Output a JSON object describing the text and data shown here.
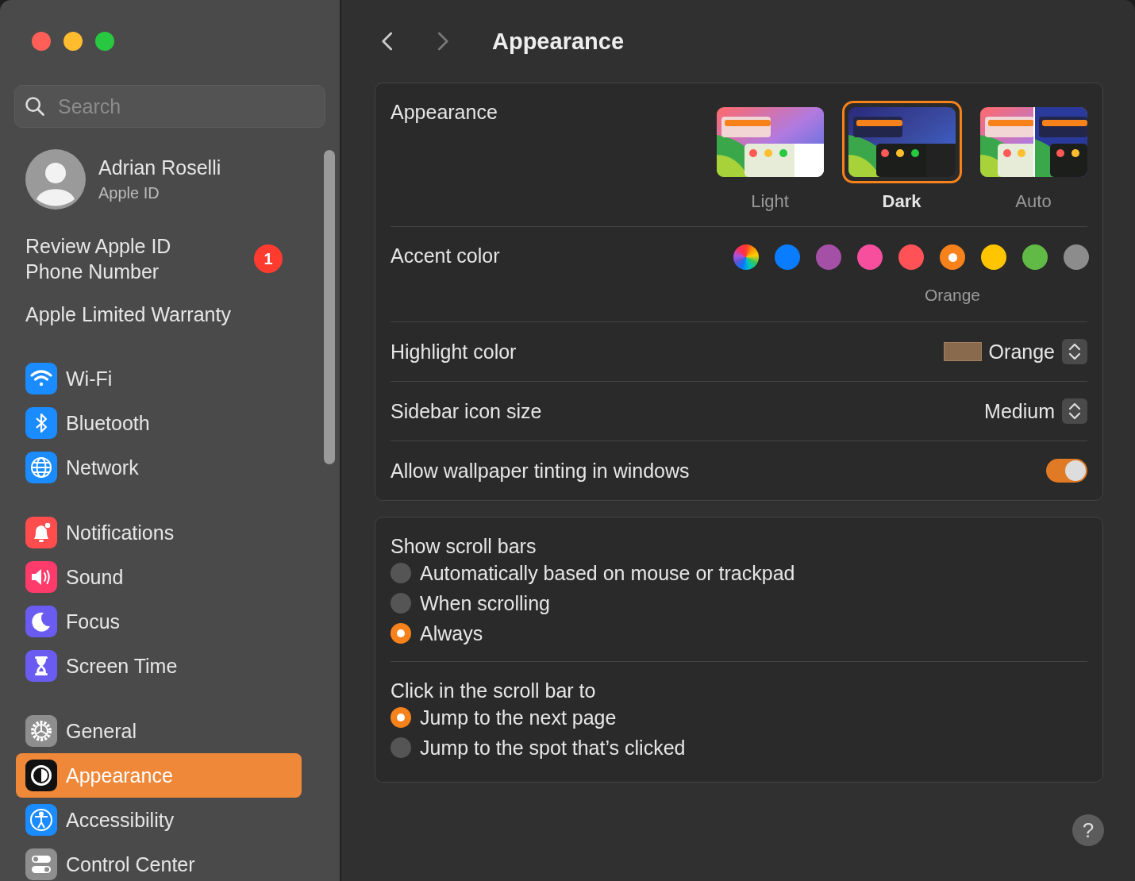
{
  "window": {
    "title": "Appearance"
  },
  "sidebar": {
    "search": {
      "placeholder": "Search"
    },
    "profile": {
      "name": "Adrian Roselli",
      "subtitle": "Apple ID"
    },
    "notices": [
      {
        "label": "Review Apple ID Phone Number",
        "badge": "1"
      },
      {
        "label": "Apple Limited Warranty"
      }
    ],
    "groups": [
      [
        {
          "kind": "wifi",
          "label": "Wi-Fi",
          "selected": false
        },
        {
          "kind": "bluetooth",
          "label": "Bluetooth",
          "selected": false
        },
        {
          "kind": "network",
          "label": "Network",
          "selected": false
        }
      ],
      [
        {
          "kind": "notifications",
          "label": "Notifications",
          "selected": false
        },
        {
          "kind": "sound",
          "label": "Sound",
          "selected": false
        },
        {
          "kind": "focus",
          "label": "Focus",
          "selected": false
        },
        {
          "kind": "screentime",
          "label": "Screen Time",
          "selected": false
        }
      ],
      [
        {
          "kind": "general",
          "label": "General",
          "selected": false
        },
        {
          "kind": "appearance",
          "label": "Appearance",
          "selected": true
        },
        {
          "kind": "accessibility",
          "label": "Accessibility",
          "selected": false
        },
        {
          "kind": "controlcenter",
          "label": "Control Center",
          "selected": false
        }
      ]
    ]
  },
  "appearance": {
    "label": "Appearance",
    "options": [
      {
        "kind": "light",
        "label": "Light",
        "selected": false
      },
      {
        "kind": "dark",
        "label": "Dark",
        "selected": true
      },
      {
        "kind": "auto",
        "label": "Auto",
        "selected": false
      }
    ]
  },
  "accent": {
    "label": "Accent color",
    "selected_name": "Orange",
    "colors": [
      {
        "kind": "multicolor",
        "selected": false
      },
      {
        "kind": "solid",
        "color": "#0a7cff",
        "selected": false
      },
      {
        "kind": "solid",
        "color": "#a550a7",
        "selected": false
      },
      {
        "kind": "solid",
        "color": "#f74f9e",
        "selected": false
      },
      {
        "kind": "solid",
        "color": "#ff5257",
        "selected": false
      },
      {
        "kind": "solid",
        "color": "#f7821b",
        "selected": true
      },
      {
        "kind": "solid",
        "color": "#ffc600",
        "selected": false
      },
      {
        "kind": "solid",
        "color": "#62ba46",
        "selected": false
      },
      {
        "kind": "solid",
        "color": "#8c8c8c",
        "selected": false
      }
    ]
  },
  "highlight": {
    "label": "Highlight color",
    "value": "Orange"
  },
  "icon_size": {
    "label": "Sidebar icon size",
    "value": "Medium"
  },
  "tinting": {
    "label": "Allow wallpaper tinting in windows",
    "on": true
  },
  "scroll_groups": [
    {
      "title": "Show scroll bars",
      "options": [
        {
          "label": "Automatically based on mouse or trackpad",
          "selected": false
        },
        {
          "label": "When scrolling",
          "selected": false
        },
        {
          "label": "Always",
          "selected": true
        }
      ]
    },
    {
      "title": "Click in the scroll bar to",
      "options": [
        {
          "label": "Jump to the next page",
          "selected": true
        },
        {
          "label": "Jump to the spot that’s clicked",
          "selected": false
        }
      ]
    }
  ],
  "help": "?"
}
